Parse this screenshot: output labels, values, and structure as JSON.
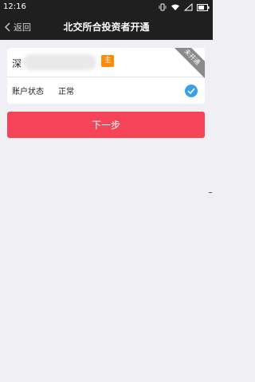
{
  "status_bar": {
    "time": "12:16"
  },
  "nav": {
    "back_label": "返回",
    "title": "北交所合投资者开通"
  },
  "account": {
    "prefix": "深",
    "main_badge": "主",
    "ribbon": "未开通",
    "status_label": "账户状态",
    "status_value": "正常",
    "selected": true
  },
  "actions": {
    "next_label": "下一步"
  },
  "colors": {
    "accent": "#f54358",
    "check": "#3aa0e8",
    "badge": "#ff8a00",
    "ribbon": "#8a8a8a"
  }
}
